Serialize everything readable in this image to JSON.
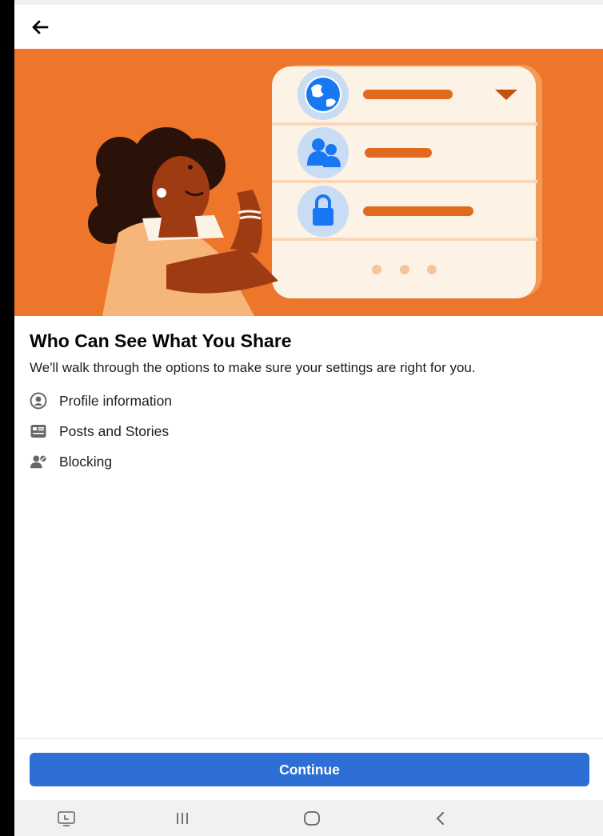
{
  "header": {
    "back_icon": "arrow-left-icon"
  },
  "hero": {
    "colors": {
      "background": "#ee762a",
      "card": "#fdf2e6",
      "accent_line": "#e16a1f",
      "icon_circle": "#c8dcf3",
      "icon_blue": "#1877f2"
    },
    "rows": [
      {
        "icon": "globe-icon"
      },
      {
        "icon": "people-icon"
      },
      {
        "icon": "lock-icon"
      }
    ],
    "pagination_dots": 3
  },
  "main": {
    "title": "Who Can See What You Share",
    "subtitle": "We'll walk through the options to make sure your settings are right for you.",
    "items": [
      {
        "icon": "profile-circle-icon",
        "label": "Profile information"
      },
      {
        "icon": "posts-card-icon",
        "label": "Posts and Stories"
      },
      {
        "icon": "blocked-user-icon",
        "label": "Blocking"
      }
    ]
  },
  "footer": {
    "continue_label": "Continue",
    "button_color": "#2d6fd4"
  },
  "system_nav": {
    "buttons": [
      "screenshot-icon",
      "recents-icon",
      "home-icon",
      "back-chevron-icon"
    ]
  }
}
